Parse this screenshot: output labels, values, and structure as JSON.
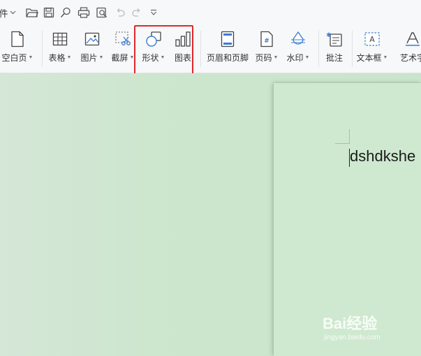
{
  "qat": {
    "file_partial": "件",
    "icons": [
      "chevron-down-icon",
      "open-folder-icon",
      "save-icon",
      "search-replace-icon",
      "print-icon",
      "print-preview-icon",
      "undo-icon",
      "redo-icon",
      "customize-icon"
    ]
  },
  "ribbon": {
    "items": [
      {
        "label": "空白页",
        "icon": "blank-page-icon",
        "dropdown": true
      },
      {
        "label": "表格",
        "icon": "table-icon",
        "dropdown": true
      },
      {
        "label": "图片",
        "icon": "picture-icon",
        "dropdown": true
      },
      {
        "label": "截屏",
        "icon": "screenshot-icon",
        "dropdown": true
      },
      {
        "label": "形状",
        "icon": "shape-icon",
        "dropdown": true
      },
      {
        "label": "图表",
        "icon": "chart-icon",
        "dropdown": false
      },
      {
        "label": "页眉和页脚",
        "icon": "header-footer-icon",
        "dropdown": false
      },
      {
        "label": "页码",
        "icon": "page-number-icon",
        "dropdown": true
      },
      {
        "label": "水印",
        "icon": "watermark-icon",
        "dropdown": true
      },
      {
        "label": "批注",
        "icon": "comment-icon",
        "dropdown": false
      },
      {
        "label": "文本框",
        "icon": "textbox-icon",
        "dropdown": true
      },
      {
        "label": "艺术字",
        "icon": "wordart-icon",
        "dropdown": false
      }
    ],
    "highlight_color": "#e0282a"
  },
  "document": {
    "text": "dshdkshe"
  },
  "watermark": {
    "brand": "Bai经验",
    "sub": "jingyan.baidu.com"
  },
  "colors": {
    "canvas": "#cde6ce",
    "page": "#cee9cf",
    "toolbar": "#f7f8f9",
    "icon_blue": "#3a7bd5"
  }
}
